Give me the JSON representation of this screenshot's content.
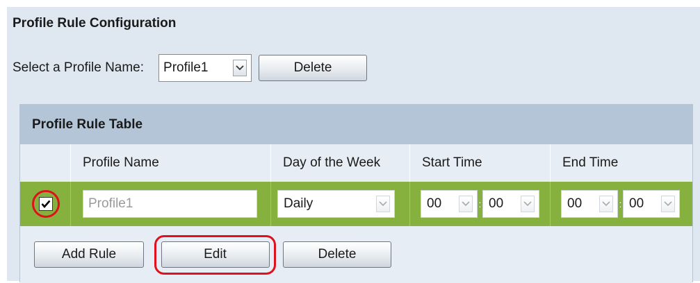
{
  "section": {
    "title": "Profile Rule Configuration"
  },
  "profile_select": {
    "label": "Select a Profile Name:",
    "value": "Profile1",
    "delete_label": "Delete"
  },
  "table": {
    "title": "Profile Rule Table",
    "columns": [
      "",
      "Profile Name",
      "Day of the Week",
      "Start Time",
      "End Time"
    ],
    "rows": [
      {
        "checked": true,
        "profile_name": "Profile1",
        "day": "Daily",
        "start_hour": "00",
        "start_min": "00",
        "end_hour": "00",
        "end_min": "00"
      }
    ]
  },
  "actions": {
    "add_rule_label": "Add Rule",
    "edit_label": "Edit",
    "delete_label": "Delete"
  },
  "colors": {
    "panel_bg": "#dfe8f1",
    "table_title_bg": "#b3c5d6",
    "selected_row_bg": "#86b13e",
    "highlight_ring": "#e0101c"
  },
  "icons": {
    "dropdown": "chevron-down-icon",
    "checkbox": "checkmark-icon"
  }
}
